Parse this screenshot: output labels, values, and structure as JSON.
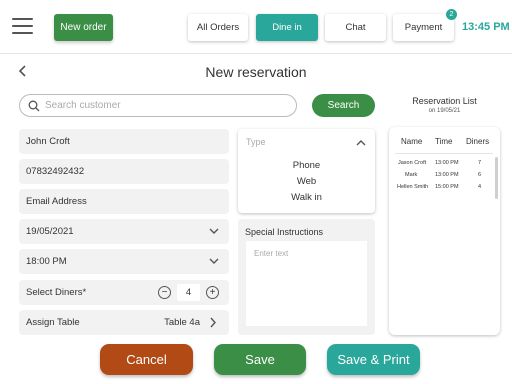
{
  "topbar": {
    "new_order": "New order",
    "tabs": [
      {
        "label": "All Orders",
        "active": false
      },
      {
        "label": "Dine in",
        "active": true
      },
      {
        "label": "Chat",
        "active": false
      },
      {
        "label": "Payment",
        "active": false,
        "badge": "2"
      }
    ],
    "time": "13:45 PM"
  },
  "header": {
    "title": "New reservation"
  },
  "search": {
    "placeholder": "Search customer",
    "button": "Search"
  },
  "form": {
    "name": "John Croft",
    "phone": "07832492432",
    "email_placeholder": "Email Address",
    "date": "19/05/2021",
    "time": "18:00 PM",
    "diners_label": "Select Diners*",
    "diners_value": "4",
    "assign_label": "Assign Table",
    "assign_value": "Table 4a"
  },
  "type_select": {
    "label": "Type",
    "options": [
      "Phone",
      "Web",
      "Walk in"
    ]
  },
  "special": {
    "label": "Special Instructions",
    "placeholder": "Enter text"
  },
  "reservation_list": {
    "title": "Reservation List",
    "subtitle": "on 19/05/21",
    "columns": [
      "Name",
      "Time",
      "Diners"
    ],
    "rows": [
      {
        "name": "Jason Croft",
        "time": "13:00 PM",
        "diners": "7"
      },
      {
        "name": "Mark",
        "time": "13:00 PM",
        "diners": "6"
      },
      {
        "name": "Hellen Smith",
        "time": "15:00 PM",
        "diners": "4"
      }
    ]
  },
  "actions": {
    "cancel": "Cancel",
    "save": "Save",
    "save_print": "Save & Print"
  },
  "colors": {
    "green": "#3b8e45",
    "teal": "#2aa79b",
    "cancel": "#b24a16",
    "field_bg": "#f2f2f2"
  },
  "icons": [
    "hamburger-icon",
    "back-arrow-icon",
    "search-icon",
    "chevron-down-icon",
    "chevron-up-icon",
    "chevron-right-icon",
    "minus-circle-icon",
    "plus-circle-icon"
  ]
}
